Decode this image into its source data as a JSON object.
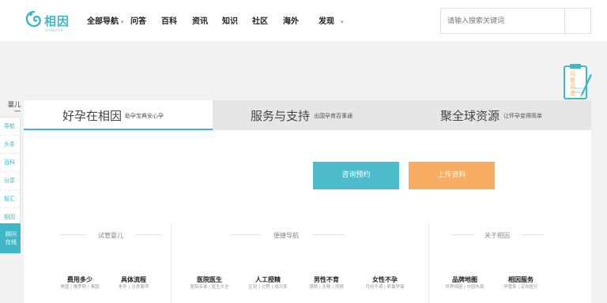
{
  "header": {
    "logo_text": "相因",
    "logo_sub": "XIANGYIN",
    "nav": [
      {
        "label": "全部导航",
        "has_caret": true
      },
      {
        "label": "问答"
      },
      {
        "label": "百科"
      },
      {
        "label": "资讯"
      },
      {
        "label": "知识"
      },
      {
        "label": "社区"
      },
      {
        "label": "海外"
      },
      {
        "label": "发现",
        "has_caret": true
      }
    ],
    "search_placeholder": "请输入搜索关键词"
  },
  "survey": {
    "label": "问卷调查"
  },
  "sidebar": {
    "head": "婴儿\n一",
    "items": [
      "导航",
      "头条",
      "百科",
      "分享",
      "智汇",
      "相因"
    ],
    "cta": "顾问\n在线"
  },
  "tabs": [
    {
      "title": "好孕在相因",
      "sub": "助孕宝典安心孕",
      "active": true
    },
    {
      "title": "服务与支持",
      "sub": "出国孕育百事通",
      "active": false
    },
    {
      "title": "聚全球资源",
      "sub": "让怀孕变得简单",
      "active": false
    }
  ],
  "actions": {
    "consult": "咨询预约",
    "upload": "上传资料"
  },
  "columns": [
    {
      "head": "试管婴儿",
      "links": [
        {
          "title": "费用多少",
          "sub": "美国 | 俄罗斯 | 泰国"
        },
        {
          "title": "具体流程",
          "sub": "条件 | 注意事项"
        }
      ]
    },
    {
      "head": "便捷导航",
      "links": [
        {
          "title": "医院医生",
          "sub": "医院名录 | 医生大全"
        },
        {
          "title": "人工授精",
          "sub": "区别 | 过程 | 成功率"
        },
        {
          "title": "男性不育",
          "sub": "弱精 | 无精 | 死精"
        },
        {
          "title": "女性不孕",
          "sub": "月经不调 | 卵巢早衰"
        }
      ]
    },
    {
      "head": "关于相因",
      "links": [
        {
          "title": "品牌地图",
          "sub": "世界相因 | 中国布局"
        },
        {
          "title": "相因服务",
          "sub": "孕管家 | 定制医疗"
        }
      ]
    }
  ],
  "colors": {
    "brand": "#3fb7c6",
    "accent_orange": "#f8ad63",
    "button_teal": "#4dbccb"
  },
  "icons": [
    "logo-icon",
    "search-icon",
    "survey-clipboard-icon",
    "chevron-down-icon"
  ]
}
